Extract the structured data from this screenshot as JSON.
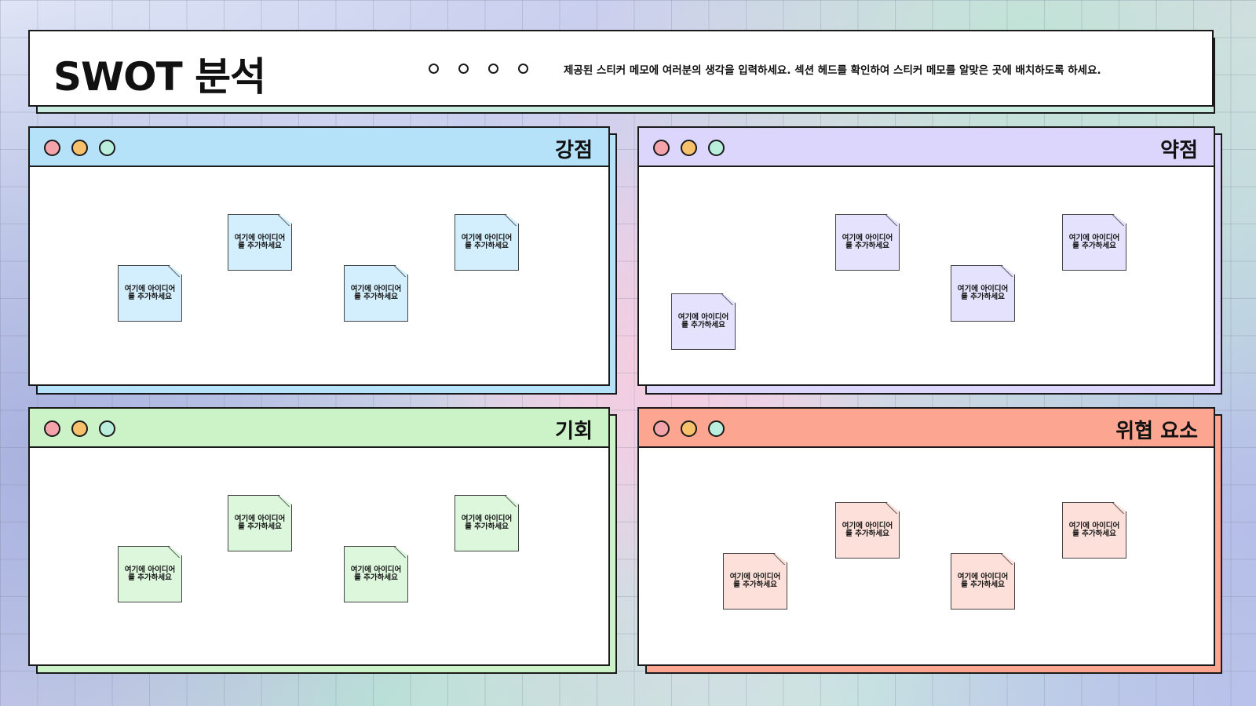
{
  "header": {
    "title": "SWOT 분석",
    "instructions": "제공된 스티커 메모에 여러분의 생각을 입력하세요. 섹션 헤드를 확인하여 스티커 메모를 알맞은 곳에 배치하도록 하세요."
  },
  "colors": {
    "dot_red": "#f4a3aa",
    "dot_orange": "#f7c06a",
    "dot_mint": "#b9efdc",
    "strengths_bar": "#b5e1f9",
    "strengths_note": "#d3eefc",
    "weaknesses_bar": "#dcd6fd",
    "weaknesses_note": "#e4e2fd",
    "opportunities_bar": "#ccf2c8",
    "opportunities_note": "#ddf7dc",
    "threats_bar": "#fca591",
    "threats_note": "#fde0d9"
  },
  "panels": {
    "strengths": {
      "title": "강점",
      "notes": [
        "여기에 아이디어를 추가하세요",
        "여기에 아이디어를 추가하세요",
        "여기에 아이디어를 추가하세요",
        "여기에 아이디어를 추가하세요"
      ]
    },
    "weaknesses": {
      "title": "약점",
      "notes": [
        "여기에 아이디어를 추가하세요",
        "여기에 아이디어를 추가하세요",
        "여기에 아이디어를 추가하세요",
        "여기에 아이디어를 추가하세요"
      ]
    },
    "opportunities": {
      "title": "기회",
      "notes": [
        "여기에 아이디어를 추가하세요",
        "여기에 아이디어를 추가하세요",
        "여기에 아이디어를 추가하세요",
        "여기에 아이디어를 추가하세요"
      ]
    },
    "threats": {
      "title": "위협 요소",
      "notes": [
        "여기에 아이디어를 추가하세요",
        "여기에 아이디어를 추가하세요",
        "여기에 아이디어를 추가하세요",
        "여기에 아이디어를 추가하세요"
      ]
    }
  }
}
